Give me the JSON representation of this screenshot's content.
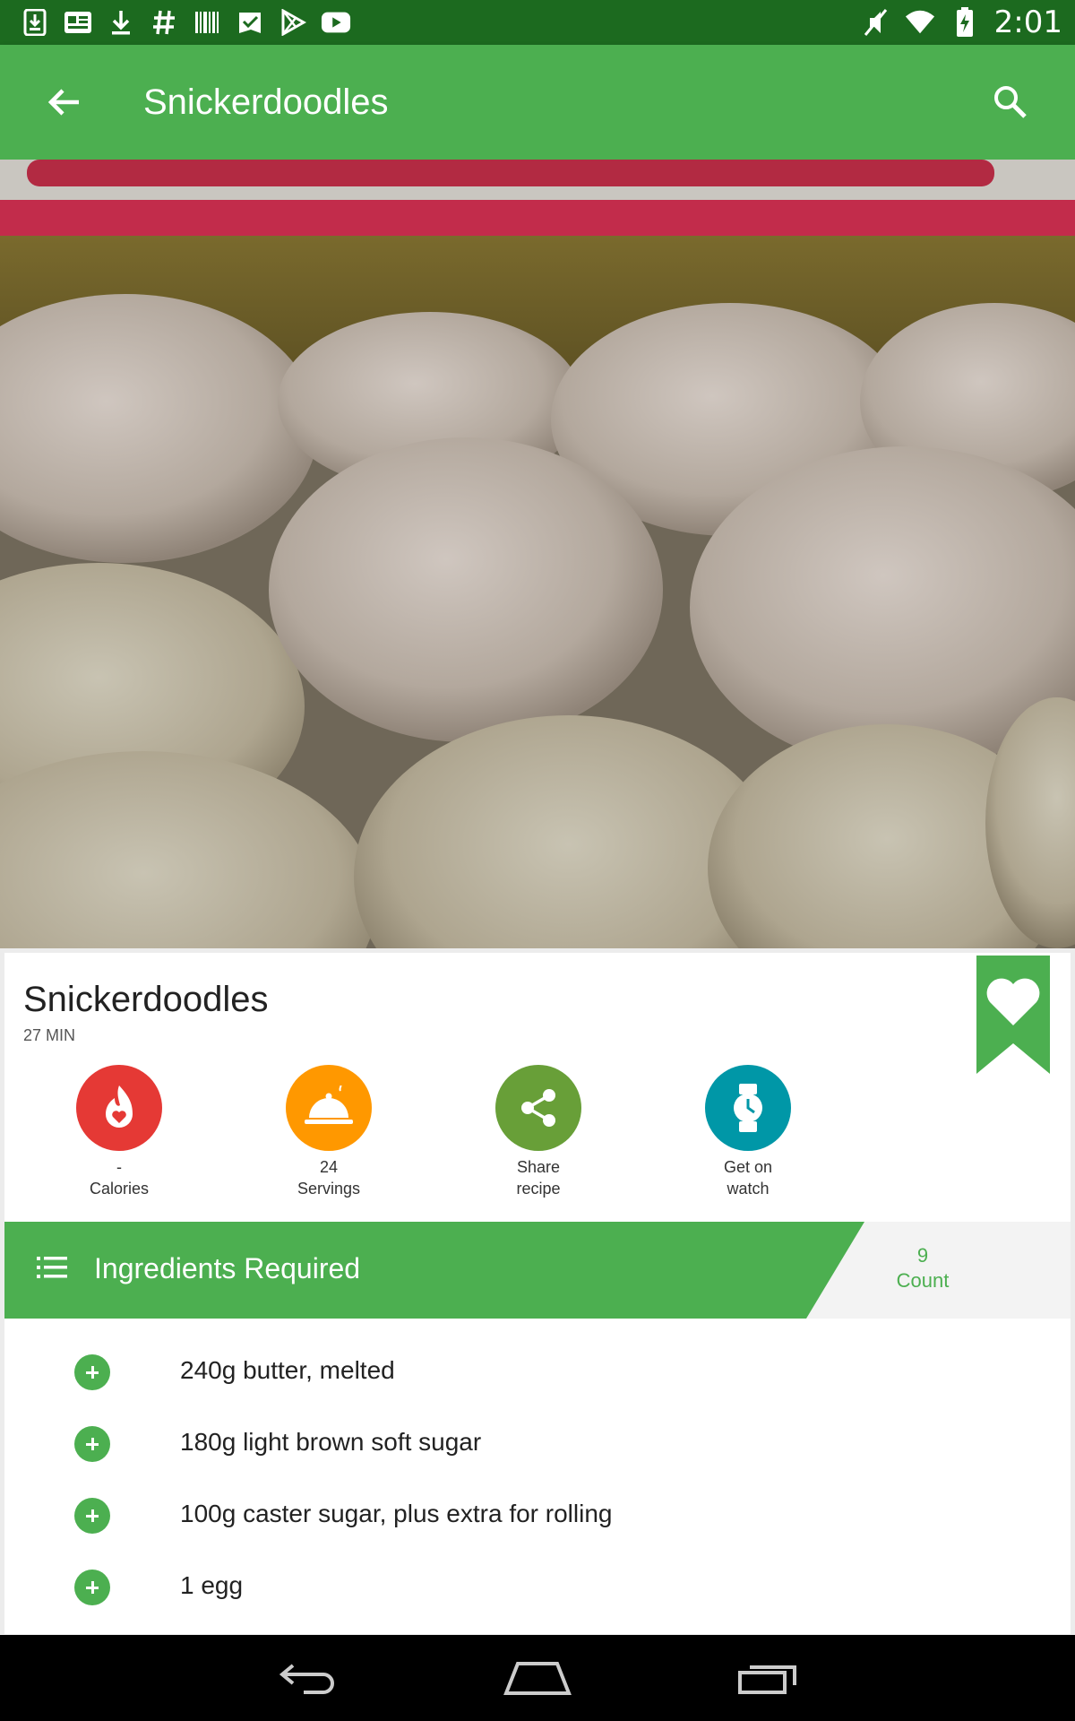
{
  "status_bar": {
    "time": "2:01",
    "left_icons": [
      "download-icon",
      "news-icon",
      "download-icon",
      "hashtag-icon",
      "barcode-icon",
      "check-flag-icon",
      "play-store-icon",
      "youtube-icon"
    ],
    "right_icons": [
      "mute-icon",
      "wifi-icon",
      "battery-charging-icon"
    ]
  },
  "toolbar": {
    "title": "Snickerdoodles"
  },
  "recipe": {
    "name": "Snickerdoodles",
    "time": "27 MIN"
  },
  "actions": [
    {
      "id": "calories",
      "line1": "-",
      "line2": "Calories",
      "color": "#e53935",
      "icon": "flame-heart-icon"
    },
    {
      "id": "servings",
      "line1": "24",
      "line2": "Servings",
      "color": "#ff9800",
      "icon": "cloche-icon"
    },
    {
      "id": "share",
      "line1": "Share",
      "line2": "recipe",
      "color": "#689f38",
      "icon": "share-icon"
    },
    {
      "id": "watch",
      "line1": "Get on",
      "line2": "watch",
      "color": "#0097a7",
      "icon": "watch-icon"
    }
  ],
  "ingredients": {
    "title": "Ingredients Required",
    "count_value": "9",
    "count_label": "Count",
    "items": [
      "240g butter, melted",
      "180g light brown soft sugar",
      "100g caster sugar, plus extra for rolling",
      "1 egg"
    ]
  },
  "colors": {
    "accent": "#4caf50",
    "status_bar": "#1c6a1f"
  }
}
